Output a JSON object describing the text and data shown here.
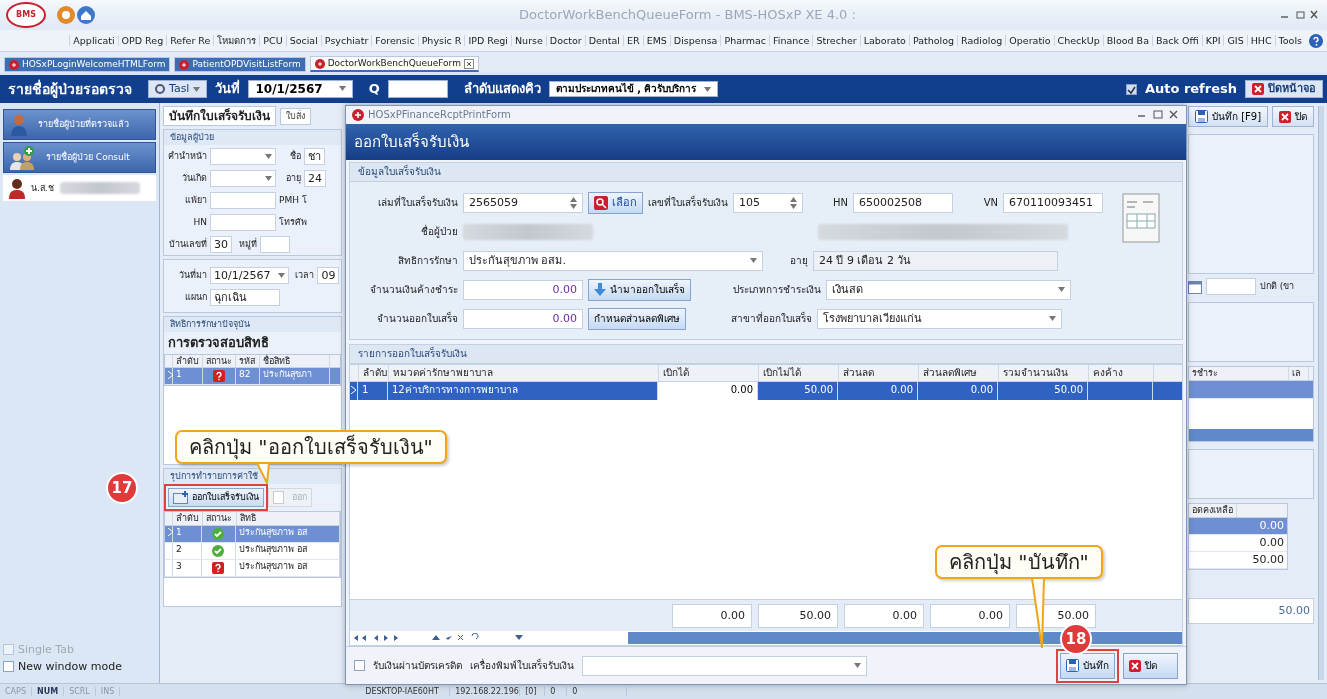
{
  "window": {
    "title": "DoctorWorkBenchQueueForm - BMS-HOSxP XE 4.0 :",
    "logo": "BMS"
  },
  "menu": [
    "Applicati",
    "OPD Reg",
    "Refer Re",
    "โหมดการ",
    "PCU",
    "Social",
    "Psychiatr",
    "Forensic",
    "Physic R",
    "IPD Regi",
    "Nurse",
    "Doctor",
    "Dental",
    "ER",
    "EMS",
    "Dispensa",
    "Pharmac",
    "Finance",
    "Strecher",
    "Laborato",
    "Patholog",
    "Radiolog",
    "Operatio",
    "CheckUp",
    "Blood Ba",
    "Back Offi",
    "KPI",
    "GIS",
    "HHC",
    "Tools"
  ],
  "doc_tabs": [
    {
      "label": "HOSxPLoginWelcomeHTMLForm",
      "selected": false
    },
    {
      "label": "PatientOPDVisitListForm",
      "selected": false
    },
    {
      "label": "DoctorWorkBenchQueueForm",
      "selected": true
    }
  ],
  "queue_bar": {
    "title": "รายชื่อผู้ป่วยรอตรวจ",
    "task_button": "Tasl",
    "date_label": "วันที่",
    "date": "10/1/2567",
    "q_label": "Q",
    "order_label": "ลำดับแสดงคิว",
    "order_value": "ตามประเภทคนไข้ , คิวรับบริการ",
    "auto_refresh": {
      "label": "Auto refresh",
      "checked": true
    },
    "close_screen": "ปิดหน้าจอ"
  },
  "sidebar": {
    "items": [
      {
        "label": "รายชื่อผู้ป่วยที่ตรวจแล้ว",
        "kind": "doctor"
      },
      {
        "label": "รายชื่อผู้ป่วย Consult",
        "kind": "consult"
      }
    ],
    "patient": "น.ส.ช",
    "options": [
      {
        "label": "Single Tab",
        "checked": false,
        "disabled": true
      },
      {
        "label": "New window mode",
        "checked": false,
        "disabled": false
      }
    ]
  },
  "record_form": {
    "tabs": [
      {
        "label": "บันทึกใบเสร็จรับเงิน",
        "selected": true
      },
      {
        "label": "ใบสั่ง",
        "selected": false
      }
    ],
    "patient_title": "ข้อมูลผู้ป่วย",
    "patient_rows": [
      [
        {
          "label": "คำนำหน้า",
          "kind": "redacted-dropdown"
        },
        {
          "label": "ชื่อ",
          "value": "ชา",
          "kind": "text"
        }
      ],
      [
        {
          "label": "วันเกิด",
          "kind": "redacted-dropdown"
        },
        {
          "label": "อายุ",
          "value": "24",
          "kind": "text"
        }
      ],
      [
        {
          "label": "แพ้ยา",
          "kind": "redacted"
        },
        {
          "label": "PMH โ",
          "kind": "label"
        }
      ],
      [
        {
          "label": "HN",
          "kind": "redacted"
        },
        {
          "label": "โทรศัพ",
          "kind": "label"
        }
      ],
      [
        {
          "label": "บ้านเลขที่",
          "value": "30",
          "kind": "text"
        },
        {
          "label": "หมู่ที่",
          "kind": "text"
        }
      ]
    ],
    "visit_rows": [
      [
        {
          "label": "วันที่มา",
          "value": "10/1/2567",
          "kind": "dropdown"
        },
        {
          "label": "เวลา",
          "value": "09",
          "kind": "text"
        }
      ],
      [
        {
          "label": "แผนก",
          "value": "ฉุกเฉิน",
          "kind": "text"
        }
      ]
    ],
    "rights_title": "สิทธิการรักษาปัจจุบัน",
    "rights_heading": "การตรวจสอบสิทธิ",
    "rights_columns": [
      "ลำดับ",
      "สถานะ",
      "รหัส",
      "ชื่อสิทธิ"
    ],
    "rights_rows": [
      {
        "number": "1",
        "kind": "question",
        "code": "82",
        "name": "ประกันสุขภา",
        "selected": true
      }
    ],
    "summary_title": "รุปการทำรายการค่าใช้",
    "summary_buttons": [
      {
        "label": "ออกใบเสร็จรับเงิน",
        "disabled": false
      },
      {
        "label": "ออก",
        "disabled": true
      }
    ],
    "summary_columns": [
      "ลำดับ",
      "สถานะ",
      "สิทธิ"
    ],
    "summary_rows": [
      {
        "number": "1",
        "kind": "ok",
        "name": "ประกันสุขภาพ อส",
        "selected": true
      },
      {
        "number": "2",
        "kind": "ok",
        "name": "ประกันสุขภาพ อส",
        "selected": false
      },
      {
        "number": "3",
        "kind": "question",
        "name": "ประกันสุขภาพ อส",
        "selected": false
      }
    ]
  },
  "right_panel": {
    "buttons": [
      {
        "label": "บันทึก [F9]",
        "kind": "save"
      },
      {
        "label": "ปิด",
        "kind": "close"
      }
    ],
    "field_value": "ปกติ (ขา",
    "rights_columns": [
      "รชำระ",
      "เล"
    ],
    "balance_column": "อดคงเหลือ",
    "balances": [
      "0.00",
      "0.00",
      "50.00"
    ],
    "total": "50.00"
  },
  "dialog": {
    "title": "HOSxPFinanceRcptPrintForm",
    "header": "ออกใบเสร็จรับเงิน",
    "section": "ข้อมูลใบเสร็จรับเงิน",
    "book_label": "เล่มที่ใบเสร็จรับเงิน",
    "book": "2565059",
    "choose_button": "เลือก",
    "number_label": "เลขที่ใบเสร็จรับเงิน",
    "number": "105",
    "hn_label": "HN",
    "hn": "650002508",
    "vn_label": "VN",
    "vn": "670110093451",
    "name_label": "ชื่อผู้ป่วย",
    "rights_label": "สิทธิการรักษา",
    "rights": "ประกันสุขภาพ อสม.",
    "age_label": "อายุ",
    "age": "24 ปี 9 เดือน 2 วัน",
    "outstanding_label": "จำนวนเงินค้างชำระ",
    "outstanding": "0.00",
    "bring_button": "นำมาออกใบเสร็จ",
    "payment_label": "ประเภทการชำระเงิน",
    "payment": "เงินสด",
    "receipt_label": "จำนวนออกใบเสร็จ",
    "receipt": "0.00",
    "discount_button": "กำหนดส่วนลดพิเศษ",
    "branch_label": "สาขาที่ออกใบเสร็จ",
    "branch": "โรงพยาบาลเวียงแก่น",
    "items_title": "รายการออกใบเสร็จรับเงิน",
    "columns": [
      "ลำดับ",
      "หมวดค่ารักษาพยาบาล",
      "เบิกได้",
      "เบิกไม่ได้",
      "ส่วนลด",
      "ส่วนลดพิเศษ",
      "รวมจำนวนเงิน",
      "คงค้าง"
    ],
    "rows": [
      {
        "cells": [
          "1",
          "12ค่าบริการทางการพยาบาล",
          "0.00",
          "50.00",
          "0.00",
          "0.00",
          "50.00",
          ""
        ],
        "selected": true
      }
    ],
    "totals": [
      "0.00",
      "50.00",
      "0.00",
      "0.00",
      "50.00"
    ],
    "credit_card": {
      "label": "รับเงินผ่านบัตรเครดิต",
      "checked": false
    },
    "printer_label": "เครื่องพิมพ์ใบเสร็จรับเงิน",
    "save_button": "บันทึก",
    "close_button": "ปิด"
  },
  "callouts": [
    {
      "text": "คลิกปุ่ม \"ออกใบเสร็จรับเงิน\"",
      "step": "17"
    },
    {
      "text": "คลิกปุ่ม \"บันทึก\"",
      "step": "18"
    }
  ],
  "status_bar": {
    "keys": [
      {
        "label": "CAPS",
        "on": false
      },
      {
        "label": "NUM",
        "on": true
      },
      {
        "label": "SCRL",
        "on": false
      },
      {
        "label": "INS",
        "on": false
      }
    ],
    "cells": [
      "DESKTOP-IAE60HT",
      "192.168.22.196",
      "[0]",
      "0",
      "0"
    ]
  }
}
